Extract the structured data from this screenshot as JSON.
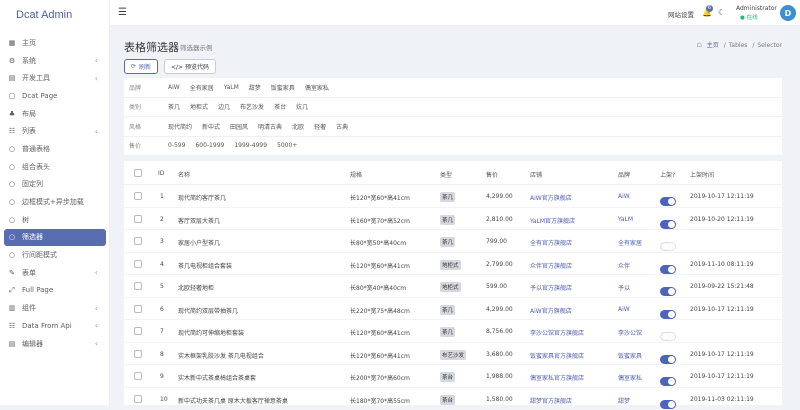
{
  "app": {
    "title": "Dcat Admin"
  },
  "sidebar": {
    "items": [
      {
        "icon": "▦",
        "label": "主页",
        "arrow": ""
      },
      {
        "icon": "⚙",
        "label": "系统",
        "arrow": "‹"
      },
      {
        "icon": "▤",
        "label": "开发工具",
        "arrow": "‹"
      },
      {
        "icon": "▢",
        "label": "Dcat Page",
        "arrow": ""
      },
      {
        "icon": "♣",
        "label": "布局",
        "arrow": ""
      },
      {
        "icon": "☷",
        "label": "列表",
        "arrow": "‹"
      },
      {
        "icon": "○",
        "label": "普通表格",
        "arrow": ""
      },
      {
        "icon": "○",
        "label": "组合表头",
        "arrow": ""
      },
      {
        "icon": "○",
        "label": "固定列",
        "arrow": ""
      },
      {
        "icon": "○",
        "label": "边框模式+异步加载",
        "arrow": ""
      },
      {
        "icon": "○",
        "label": "树",
        "arrow": ""
      },
      {
        "icon": "○",
        "label": "筛选器",
        "arrow": "",
        "active": true
      },
      {
        "icon": "○",
        "label": "行间距模式",
        "arrow": ""
      },
      {
        "icon": "✎",
        "label": "表单",
        "arrow": "‹"
      },
      {
        "icon": "⤢",
        "label": "Full Page",
        "arrow": ""
      },
      {
        "icon": "▥",
        "label": "组件",
        "arrow": "‹"
      },
      {
        "icon": "☷",
        "label": "Data From Api",
        "arrow": "‹"
      },
      {
        "icon": "▤",
        "label": "编辑器",
        "arrow": "‹"
      }
    ]
  },
  "topbar": {
    "site_settings": "网站设置",
    "bell_badge": "6",
    "user_name": "Administrator",
    "user_status": "在线",
    "avatar_letter": "D"
  },
  "page": {
    "title": "表格筛选器",
    "subtitle": "筛选器示例",
    "breadcrumb": [
      "主页",
      "Tables",
      "Selector"
    ],
    "refresh": "刷新",
    "preview_code": "</> 预览代码"
  },
  "filters": [
    {
      "label": "品牌",
      "options": [
        "AiW",
        "全有家居",
        "YaLM",
        "甜梦",
        "饭蜜家具",
        "偶室家私"
      ]
    },
    {
      "label": "类别",
      "options": [
        "茶几",
        "地柜式",
        "边几",
        "布艺沙发",
        "茶台",
        "炕几"
      ]
    },
    {
      "label": "风格",
      "options": [
        "现代简约",
        "新中式",
        "田园风",
        "明清古典",
        "北欧",
        "轻奢",
        "古典"
      ]
    },
    {
      "label": "售价",
      "options": [
        "0-599",
        "600-1999",
        "1999-4999",
        "5000+"
      ]
    }
  ],
  "table": {
    "headers": [
      "ID",
      "名称",
      "规格",
      "类型",
      "售价",
      "店铺",
      "品牌",
      "上架?",
      "上架时间"
    ],
    "rows": [
      {
        "id": "1",
        "name": "现代简约客厅茶几",
        "spec": "长120*宽60*高41cm",
        "type": "茶几",
        "price": "4,299.00",
        "shop": "AiW官方旗舰店",
        "brand": "AiW",
        "on": true,
        "time": "2019-10-17 12:11:19"
      },
      {
        "id": "2",
        "name": "客厅双层大茶几",
        "spec": "长160*宽70*高52cm",
        "type": "茶几",
        "price": "2,810.00",
        "shop": "YaLM官方旗舰店",
        "brand": "YaLM",
        "on": true,
        "time": "2019-10-20 12:11:19"
      },
      {
        "id": "3",
        "name": "家居小户型茶几",
        "spec": "长80*宽50*高40cm",
        "type": "茶几",
        "price": "799.00",
        "shop": "全有官方旗舰店",
        "brand": "全有家居",
        "on": false,
        "time": ""
      },
      {
        "id": "4",
        "name": "茶几电视柜组合套装",
        "spec": "长120*宽60*高41cm",
        "type": "地柜式",
        "price": "2,799.00",
        "shop": "众伴官方旗舰店",
        "brand": "众伴",
        "on": true,
        "time": "2019-11-10 08:11:19"
      },
      {
        "id": "5",
        "name": "北欧轻奢地柜",
        "spec": "长80*宽40*高40cm",
        "type": "地柜式",
        "price": "599.00",
        "shop": "予以官方旗舰店",
        "brand": "予以",
        "on": true,
        "time": "2019-09-22 15:21:48"
      },
      {
        "id": "6",
        "name": "现代简约双层带抽茶几",
        "spec": "长220*宽75*高48cm",
        "type": "茶几",
        "price": "4,299.00",
        "shop": "AiW官方旗舰店",
        "brand": "AiW",
        "on": true,
        "time": "2019-10-17 12:11:19"
      },
      {
        "id": "7",
        "name": "现代简约可伸缩地柜套装",
        "spec": "长120*宽60*高41cm",
        "type": "茶几",
        "price": "8,756.00",
        "shop": "李沙公馆官方旗舰店",
        "brand": "李沙公馆",
        "on": false,
        "time": ""
      },
      {
        "id": "8",
        "name": "实木框架乳胶沙发 茶几电视组合",
        "spec": "长120*宽60*高41cm",
        "type": "布艺沙发",
        "price": "3,680.00",
        "shop": "饭蜜家具官方旗舰店",
        "brand": "饭蜜家具",
        "on": true,
        "time": "2019-10-17 12:11:19"
      },
      {
        "id": "9",
        "name": "实木新中式茶桌椅组合茶桌套",
        "spec": "长200*宽70*高60cm",
        "type": "茶台",
        "price": "1,988.00",
        "shop": "偶室家私官方旗舰店",
        "brand": "偶室家私",
        "on": true,
        "time": "2019-10-17 12:11:19"
      },
      {
        "id": "10",
        "name": "新中式功夫茶几桌 原木大板客厅禅意茶桌",
        "spec": "长180*宽70*高55cm",
        "type": "茶台",
        "price": "1,580.00",
        "shop": "甜梦官方旗舰店",
        "brand": "甜梦",
        "on": true,
        "time": "2019-11-03 02:11:19"
      }
    ]
  }
}
